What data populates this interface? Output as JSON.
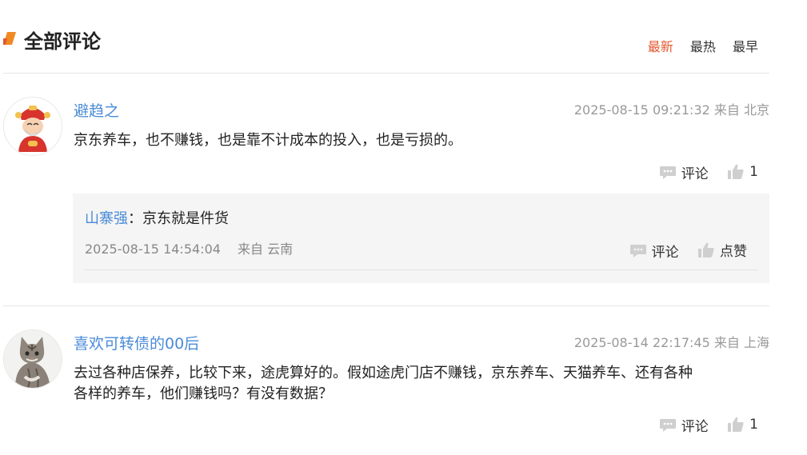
{
  "header": {
    "title": "全部评论",
    "sort_tabs": [
      {
        "label": "最新",
        "active": true
      },
      {
        "label": "最热",
        "active": false
      },
      {
        "label": "最早",
        "active": false
      }
    ],
    "accent_color": "#e4572e"
  },
  "comments": [
    {
      "username": "避趋之",
      "time": "2025-08-15 09:21:32",
      "location": "来自 北京",
      "text": "京东养车，也不赚钱，也是靠不计成本的投入，也是亏损的。",
      "comment_label": "评论",
      "like_count": "1",
      "reply": {
        "username": "山寨强",
        "text": "：京东就是件货",
        "time": "2025-08-15 14:54:04",
        "location": "来自 云南",
        "comment_label": "评论",
        "like_label": "点赞"
      }
    },
    {
      "username": "喜欢可转债的00后",
      "time": "2025-08-14 22:17:45",
      "location": "来自 上海",
      "text_line1": "去过各种店保养，比较下来，途虎算好的。假如途虎门店不赚钱，京东养车、天猫养车、还有各种",
      "text_line2": "各样的养车，他们赚钱吗？有没有数据？",
      "comment_label": "评论",
      "like_count": "1"
    }
  ]
}
